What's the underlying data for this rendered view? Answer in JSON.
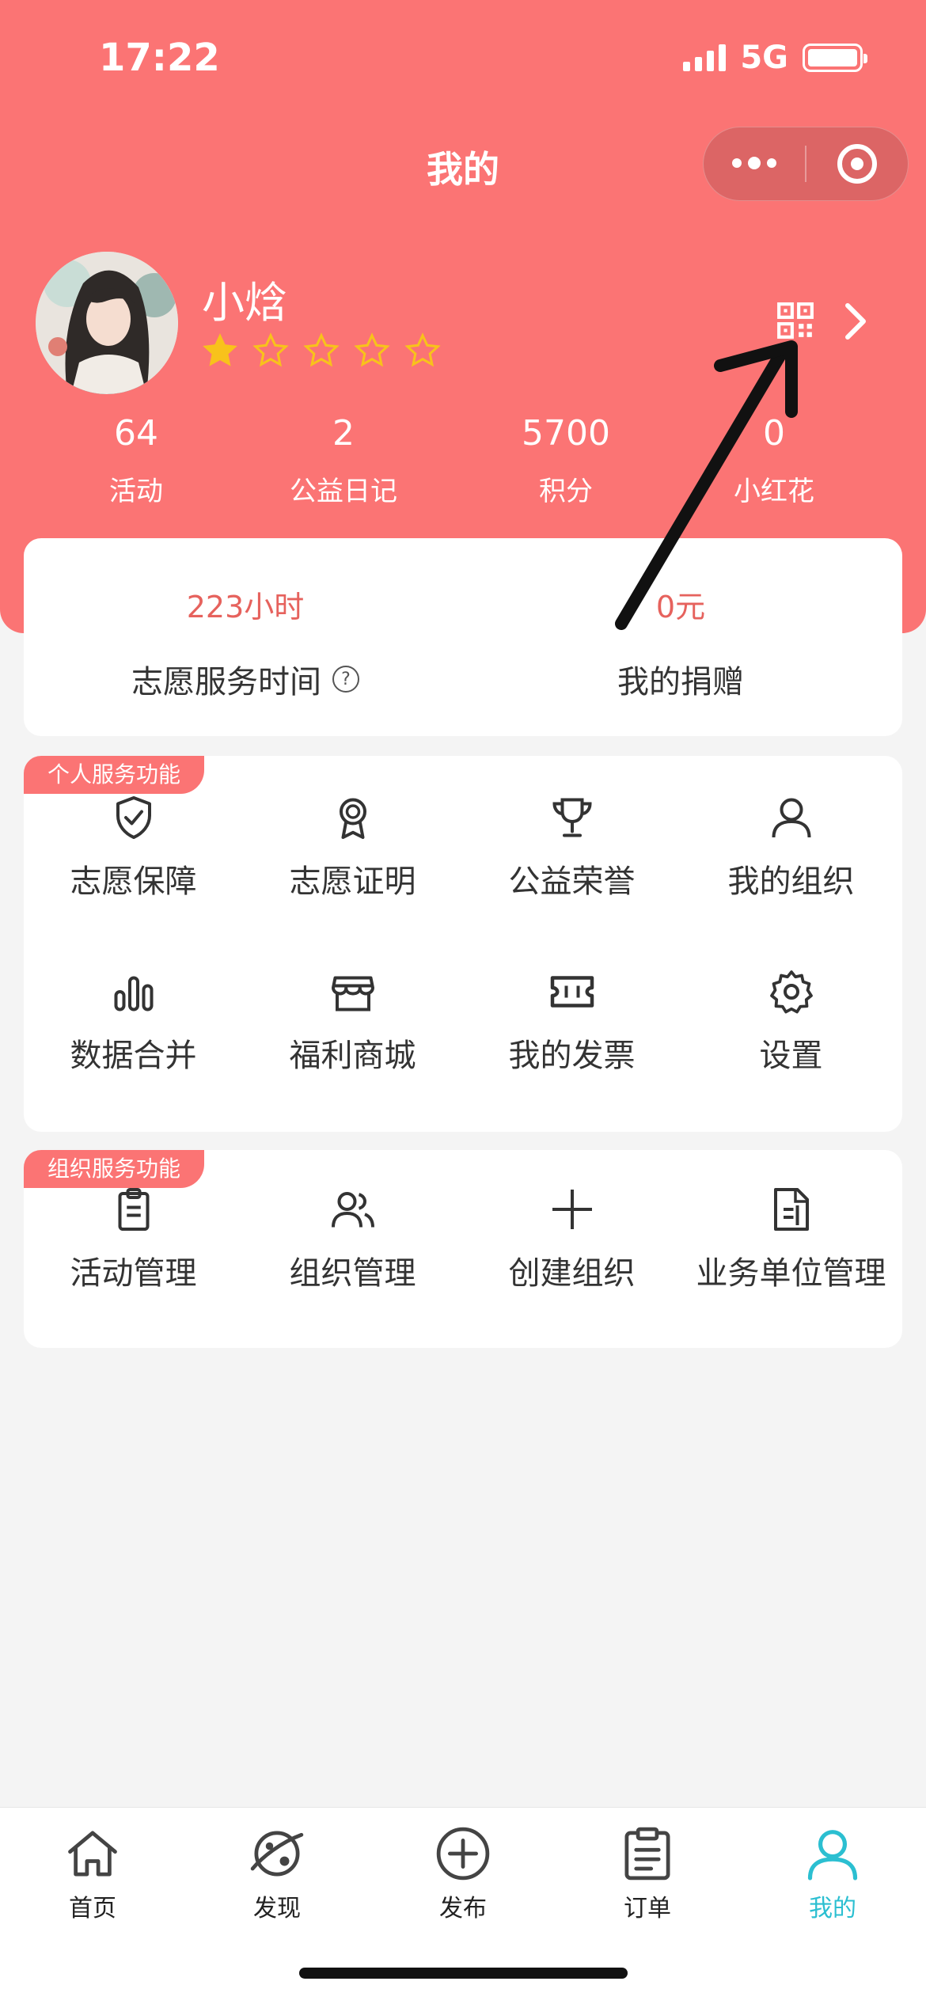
{
  "status_bar": {
    "time": "17:22",
    "network": "5G"
  },
  "header": {
    "title": "我的"
  },
  "profile": {
    "name": "小焓",
    "stars_filled": 1,
    "stars_total": 5
  },
  "stats": [
    {
      "value": "64",
      "label": "活动"
    },
    {
      "value": "2",
      "label": "公益日记"
    },
    {
      "value": "5700",
      "label": "积分"
    },
    {
      "value": "0",
      "label": "小红花"
    }
  ],
  "summary": {
    "service_hours_value": "223小时",
    "service_hours_label": "志愿服务时间",
    "help_icon": "?",
    "donation_value": "0元",
    "donation_label": "我的捐赠"
  },
  "personal_services": {
    "tag": "个人服务功能",
    "items": [
      {
        "label": "志愿保障",
        "icon": "shield-check-icon"
      },
      {
        "label": "志愿证明",
        "icon": "award-icon"
      },
      {
        "label": "公益荣誉",
        "icon": "trophy-icon"
      },
      {
        "label": "我的组织",
        "icon": "user-icon"
      },
      {
        "label": "数据合并",
        "icon": "bar-chart-icon"
      },
      {
        "label": "福利商城",
        "icon": "store-icon"
      },
      {
        "label": "我的发票",
        "icon": "ticket-icon"
      },
      {
        "label": "设置",
        "icon": "gear-icon"
      }
    ]
  },
  "org_services": {
    "tag": "组织服务功能",
    "items": [
      {
        "label": "活动管理",
        "icon": "clipboard-icon"
      },
      {
        "label": "组织管理",
        "icon": "users-icon"
      },
      {
        "label": "创建组织",
        "icon": "plus-icon"
      },
      {
        "label": "业务单位管理",
        "icon": "document-icon"
      }
    ]
  },
  "tabbar": {
    "items": [
      {
        "label": "首页",
        "icon": "home-icon"
      },
      {
        "label": "发现",
        "icon": "planet-icon"
      },
      {
        "label": "发布",
        "icon": "add-circle-icon"
      },
      {
        "label": "订单",
        "icon": "clipboard-list-icon"
      },
      {
        "label": "我的",
        "icon": "profile-icon",
        "active": true
      }
    ]
  },
  "colors": {
    "brand": "#fb7474",
    "accent": "#e6625d",
    "tab_active": "#2bbfd1"
  }
}
